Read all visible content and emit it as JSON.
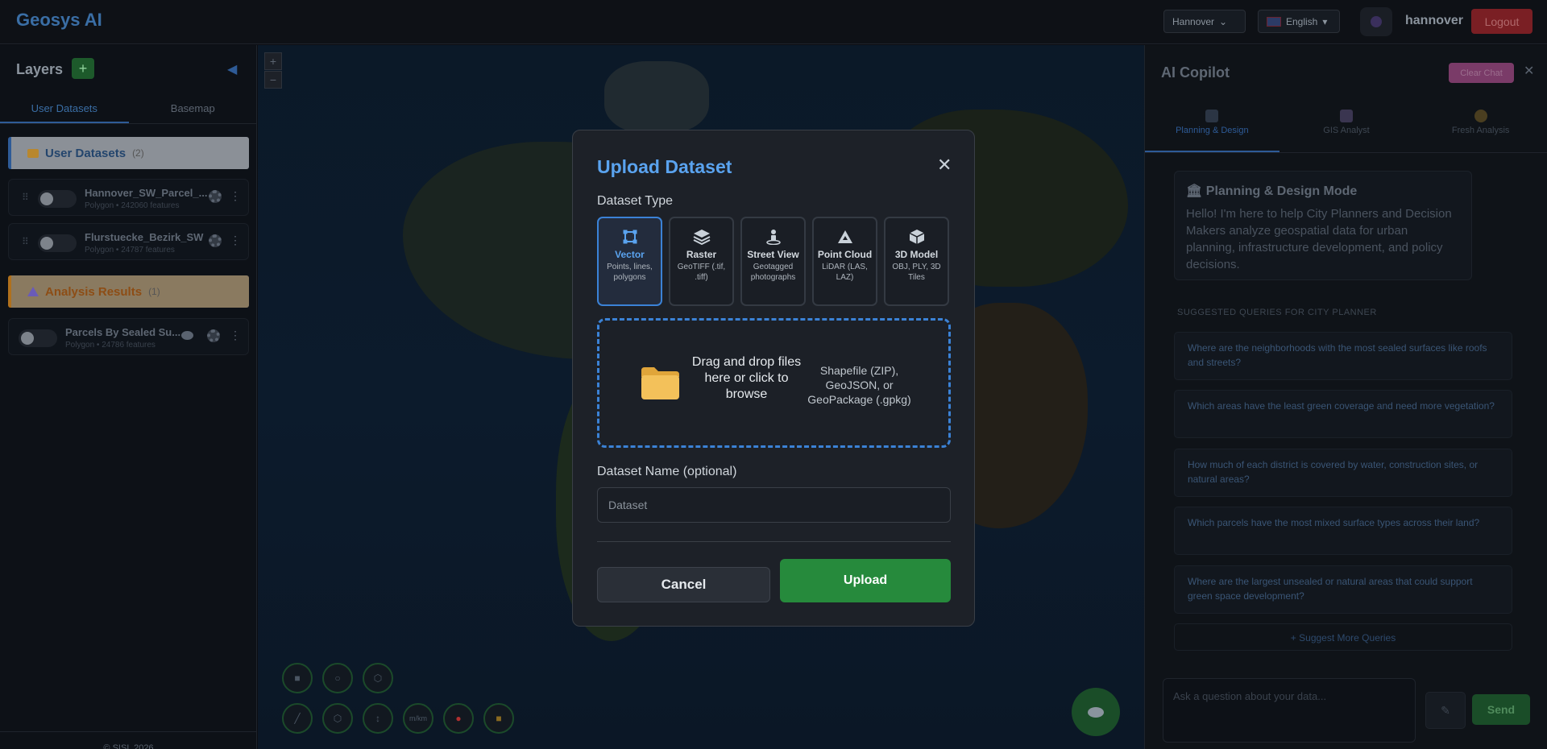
{
  "header": {
    "brand": "Geosys AI",
    "city_select": "Hannover",
    "language_select": "English",
    "username": "hannover",
    "logout_label": "Logout"
  },
  "left_panel": {
    "title": "Layers",
    "add_label": "+",
    "tabs": [
      "User Datasets",
      "Basemap"
    ],
    "groups": [
      {
        "title": "User Datasets",
        "count": "(2)"
      },
      {
        "title": "Analysis Results",
        "count": "(1)"
      }
    ],
    "layers": [
      {
        "name": "Hannover_SW_Parcel_...",
        "meta": "Polygon • 242060 features"
      },
      {
        "name": "Flurstuecke_Bezirk_SW",
        "meta": "Polygon • 24787 features"
      },
      {
        "name": "Parcels By Sealed Su...",
        "meta": "Polygon • 24786 features"
      }
    ],
    "footer": "© SISL 2026"
  },
  "map": {
    "zoom_in": "+",
    "zoom_out": "−",
    "distance_tool_label": "m/km"
  },
  "copilot": {
    "title": "AI Copilot",
    "clear_chat_label": "Clear Chat",
    "tabs": [
      {
        "label": "Planning & Design",
        "icon": "bank-icon"
      },
      {
        "label": "GIS Analyst",
        "icon": "bar-chart-icon"
      },
      {
        "label": "Fresh Analysis",
        "icon": "sparkle-icon"
      }
    ],
    "mode_title": "Planning & Design Mode",
    "mode_text": "Hello! I'm here to help City Planners and Decision Makers analyze geospatial data for urban planning, infrastructure development, and policy decisions.",
    "suggestions_heading": "SUGGESTED QUERIES FOR CITY PLANNER",
    "suggestions": [
      "Where are the neighborhoods with the most sealed surfaces like roofs and streets?",
      "Which areas have the least green coverage and need more vegetation?",
      "How much of each district is covered by water, construction sites, or natural areas?",
      "Which parcels have the most mixed surface types across their land?",
      "Where are the largest unsealed or natural areas that could support green space development?"
    ],
    "more_queries_label": "+ Suggest More Queries",
    "input_placeholder": "Ask a question about your data...",
    "send_label": "Send"
  },
  "modal": {
    "title": "Upload Dataset",
    "close_label": "✕",
    "type_label": "Dataset Type",
    "types": [
      {
        "name": "Vector",
        "desc": "Points, lines, polygons",
        "icon": "vector-icon",
        "selected": true
      },
      {
        "name": "Raster",
        "desc": "GeoTIFF (.tif, .tiff)",
        "icon": "layers-icon",
        "selected": false
      },
      {
        "name": "Street View",
        "desc": "Geotagged photographs",
        "icon": "street-view-icon",
        "selected": false
      },
      {
        "name": "Point Cloud",
        "desc": "LiDAR (LAS, LAZ)",
        "icon": "point-cloud-icon",
        "selected": false
      },
      {
        "name": "3D Model",
        "desc": "OBJ, PLY, 3D Tiles",
        "icon": "cube-icon",
        "selected": false
      }
    ],
    "dropzone_text": "Drag and drop files here or click to browse",
    "dropzone_formats": "Shapefile (ZIP), GeoJSON, or GeoPackage (.gpkg)",
    "name_label": "Dataset Name (optional)",
    "name_placeholder": "Dataset",
    "cancel_label": "Cancel",
    "upload_label": "Upload"
  },
  "colors": {
    "accent_blue": "#3b82d6",
    "upload_green": "#268a3c",
    "logout_red": "#7a1f24"
  }
}
